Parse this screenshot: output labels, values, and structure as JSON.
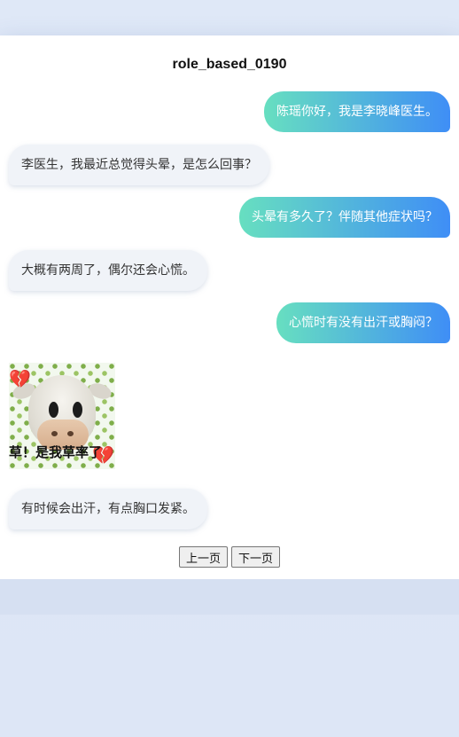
{
  "page": {
    "title": "role_based_0190"
  },
  "messages": [
    {
      "role": "doctor",
      "text": "陈瑶你好，我是李晓峰医生。"
    },
    {
      "role": "patient",
      "text": "李医生，我最近总觉得头晕，是怎么回事？"
    },
    {
      "role": "doctor",
      "text": "头晕有多久了？伴随其他症状吗？"
    },
    {
      "role": "patient",
      "text": "大概有两周了，偶尔还会心慌。"
    },
    {
      "role": "doctor",
      "text": "心慌时有没有出汗或胸闷？"
    },
    {
      "role": "patient",
      "sticker": true,
      "caption": "草！是我草率了"
    },
    {
      "role": "patient",
      "text": "有时候会出汗，有点胸口发紧。"
    }
  ],
  "sticker": {
    "caption": "草！是我草率了",
    "icon": "cow-emoji-crying-icon"
  },
  "pagination": {
    "prev_label": "上一页",
    "next_label": "下一页"
  },
  "colors": {
    "doctor_bubble_start": "#67dfc0",
    "doctor_bubble_end": "#3f8ef6",
    "patient_bubble": "#f0f3f8",
    "background": "#dfe8f7"
  }
}
